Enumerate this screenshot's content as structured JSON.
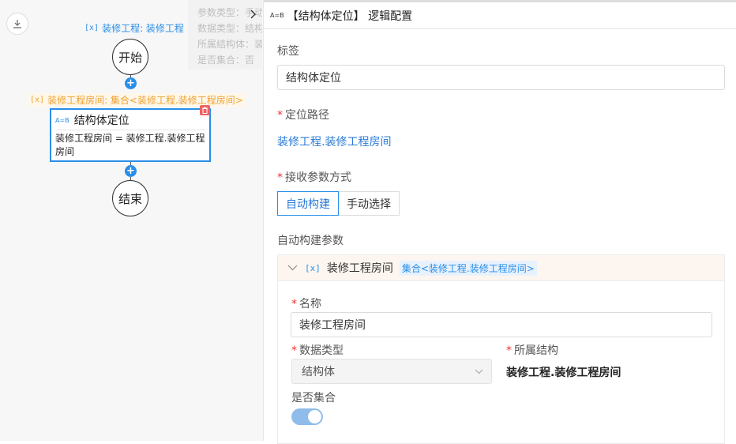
{
  "canvas": {
    "project_var": {
      "icon": "variable-icon",
      "text": "装修工程: 装修工程"
    },
    "start_node": "开始",
    "end_node": "结束",
    "room_var": {
      "icon": "variable-icon",
      "text": "装修工程房间: 集合<装修工程.装修工程房间>"
    },
    "card": {
      "icon_text": "A=B",
      "title": "结构体定位",
      "expression": "装修工程房间 = 装修工程.装修工程房间"
    },
    "tooltip": {
      "lines": [
        "参数类型：手动",
        "数据类型：结构体",
        "所属结构体：装修工程",
        "是否集合：否"
      ]
    }
  },
  "panel": {
    "header_icon_text": "A=B",
    "title": "【结构体定位】 逻辑配置",
    "label_field": {
      "label": "标签",
      "value": "结构体定位"
    },
    "path_field": {
      "label": "定位路径",
      "value": "装修工程.装修工程房间"
    },
    "receive_mode": {
      "label": "接收参数方式",
      "options": [
        "自动构建",
        "手动选择"
      ],
      "selected": "自动构建"
    },
    "auto_params": {
      "label": "自动构建参数",
      "item": {
        "name": "装修工程房间",
        "type_badge": "集合<装修工程.装修工程房间>",
        "name_field": {
          "label": "名称",
          "value": "装修工程房间"
        },
        "data_type": {
          "label": "数据类型",
          "value": "结构体"
        },
        "structure": {
          "label": "所属结构",
          "value": "装修工程.装修工程房间"
        },
        "is_collection": {
          "label": "是否集合",
          "value": true
        }
      }
    }
  },
  "colors": {
    "accent": "#2a8ee8",
    "warning": "#f0a030",
    "danger": "#f06060"
  }
}
